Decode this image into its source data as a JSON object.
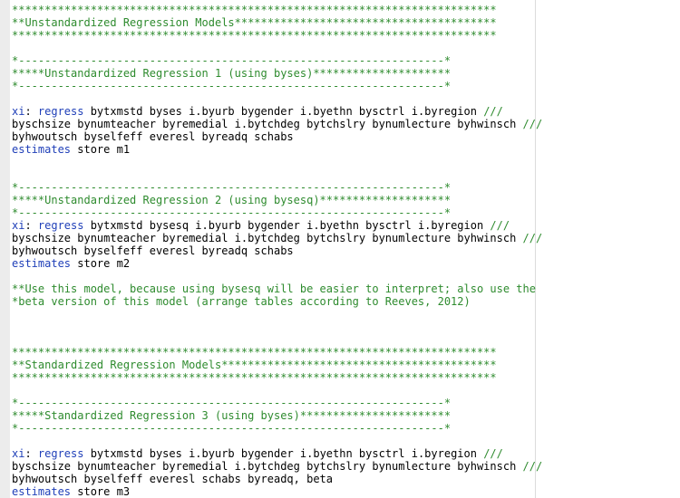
{
  "colors": {
    "comment": "#2e8b2e",
    "keyword": "#1f3fb8",
    "text": "#000000",
    "background": "#ffffff"
  },
  "lines": [
    {
      "comment": "**************************************************************************"
    },
    {
      "comment": "**Unstandardized Regression Models****************************************"
    },
    {
      "comment": "**************************************************************************"
    },
    {
      "blank": ""
    },
    {
      "comment": "*-----------------------------------------------------------------*"
    },
    {
      "comment": "*****Unstandardized Regression 1 (using byses)*********************"
    },
    {
      "comment": "*-----------------------------------------------------------------*"
    },
    {
      "blank": ""
    },
    {
      "kw1": "xi",
      "sep": ": ",
      "kw2": "regress",
      "text": " bytxmstd byses i.byurb bygender i.byethn bysctrl i.byregion ",
      "cont": "///"
    },
    {
      "text": "byschsize bynumteacher byremedial i.bytchdeg bytchslry bynumlecture byhwinsch ",
      "cont": "///"
    },
    {
      "text": "byhwoutsch byselfeff everesl byreadq schabs"
    },
    {
      "kw1": "estimates",
      "text": " store m1"
    },
    {
      "blank": ""
    },
    {
      "blank": ""
    },
    {
      "comment": "*-----------------------------------------------------------------*"
    },
    {
      "comment": "*****Unstandardized Regression 2 (using bysesq)********************"
    },
    {
      "comment": "*-----------------------------------------------------------------*"
    },
    {
      "kw1": "xi",
      "sep": ": ",
      "kw2": "regress",
      "text": " bytxmstd bysesq i.byurb bygender i.byethn bysctrl i.byregion ",
      "cont": "///"
    },
    {
      "text": "byschsize bynumteacher byremedial i.bytchdeg bytchslry bynumlecture byhwinsch ",
      "cont": "///"
    },
    {
      "text": "byhwoutsch byselfeff everesl byreadq schabs"
    },
    {
      "kw1": "estimates",
      "text": " store m2"
    },
    {
      "blank": ""
    },
    {
      "comment": "**Use this model, because using bysesq will be easier to interpret; also use the"
    },
    {
      "comment": "*beta version of this model (arrange tables according to Reeves, 2012)"
    },
    {
      "blank": ""
    },
    {
      "blank": ""
    },
    {
      "blank": ""
    },
    {
      "comment": "**************************************************************************"
    },
    {
      "comment": "**Standardized Regression Models******************************************"
    },
    {
      "comment": "**************************************************************************"
    },
    {
      "blank": ""
    },
    {
      "comment": "*-----------------------------------------------------------------*"
    },
    {
      "comment": "*****Standardized Regression 3 (using byses)***********************"
    },
    {
      "comment": "*-----------------------------------------------------------------*"
    },
    {
      "blank": ""
    },
    {
      "kw1": "xi",
      "sep": ": ",
      "kw2": "regress",
      "text": " bytxmstd byses i.byurb bygender i.byethn bysctrl i.byregion ",
      "cont": "///"
    },
    {
      "text": "byschsize bynumteacher byremedial i.bytchdeg bytchslry bynumlecture byhwinsch ",
      "cont": "///"
    },
    {
      "text": "byhwoutsch byselfeff everesl schabs byreadq, beta"
    },
    {
      "kw1": "estimates",
      "text": " store m3"
    }
  ]
}
